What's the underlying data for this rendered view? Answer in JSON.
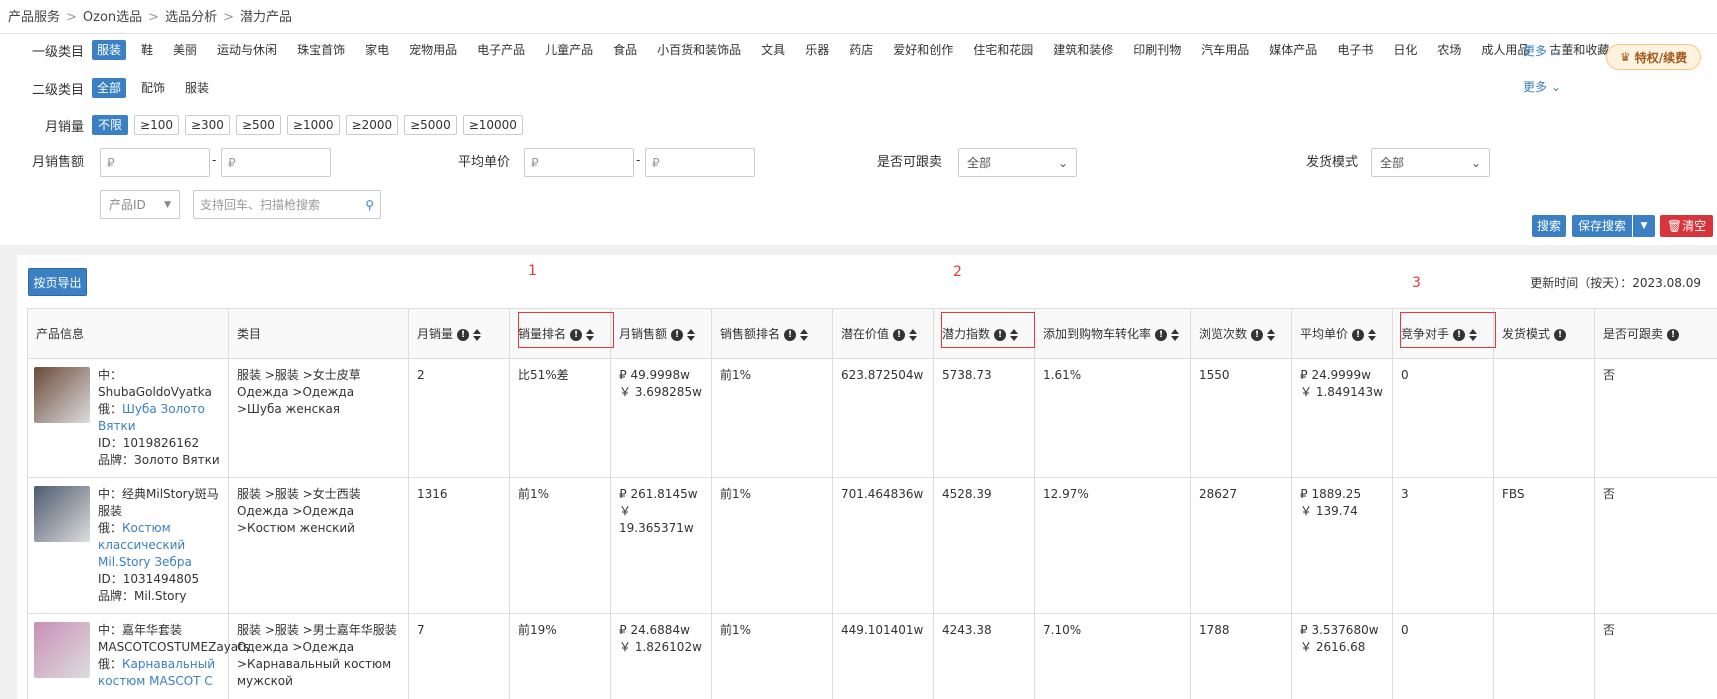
{
  "breadcrumb": [
    "产品服务",
    "Ozon选品",
    "选品分析",
    "潜力产品"
  ],
  "vip_label": "特权/续费",
  "filters": {
    "cat1": {
      "label": "一级类目",
      "items": [
        "服装",
        "鞋",
        "美丽",
        "运动与休闲",
        "珠宝首饰",
        "家电",
        "宠物用品",
        "电子产品",
        "儿童产品",
        "食品",
        "小百货和装饰品",
        "文具",
        "乐器",
        "药店",
        "爱好和创作",
        "住宅和花园",
        "建筑和装修",
        "印刷刊物",
        "汽车用品",
        "媒体产品",
        "电子书",
        "日化",
        "农场",
        "成人用品",
        "古董和收藏"
      ],
      "more": "更多"
    },
    "cat2": {
      "label": "二级类目",
      "items": [
        "全部",
        "配饰",
        "服装"
      ],
      "more": "更多"
    },
    "monthly_sales": {
      "label": "月销量",
      "items": [
        "不限",
        "≥100",
        "≥300",
        "≥500",
        "≥1000",
        "≥2000",
        "≥5000",
        "≥10000"
      ]
    },
    "monthly_amount": {
      "label": "月销售额",
      "min_placeholder": "₽",
      "max_placeholder": "₽",
      "dash": "-"
    },
    "avg_price": {
      "label": "平均单价",
      "min_placeholder": "₽",
      "max_placeholder": "₽",
      "dash": "-"
    },
    "followable": {
      "label": "是否可跟卖",
      "value": "全部"
    },
    "ship_mode": {
      "label": "发货模式",
      "value": "全部"
    },
    "id_select": "产品ID",
    "search_placeholder": "支持回车、扫描枪搜索"
  },
  "buttons": {
    "search": "搜索",
    "save_search": "保存搜索",
    "clear": "清空",
    "export": "按页导出"
  },
  "update_time": "更新时间（按天）：2023.08.09",
  "columns": [
    {
      "label": "产品信息",
      "icons": false
    },
    {
      "label": "类目",
      "icons": false
    },
    {
      "label": "月销量",
      "icons": true
    },
    {
      "label": "销量排名",
      "icons": true
    },
    {
      "label": "月销售额",
      "icons": true
    },
    {
      "label": "销售额排名",
      "icons": true
    },
    {
      "label": "潜在价值",
      "icons": true
    },
    {
      "label": "潜力指数",
      "icons": true
    },
    {
      "label": "添加到购物车转化率",
      "icons": true
    },
    {
      "label": "浏览次数",
      "icons": true
    },
    {
      "label": "平均单价",
      "icons": true
    },
    {
      "label": "竞争对手",
      "icons": true
    },
    {
      "label": "发货模式",
      "icons": "info"
    },
    {
      "label": "是否可跟卖",
      "icons": "info"
    }
  ],
  "annotations": [
    "1",
    "2",
    "3"
  ],
  "rows": [
    {
      "cn": "中：ShubaGoldoVyatka",
      "ru_label": "俄：",
      "ru": "Шуба Золото Вятки",
      "id": "ID：1019826162",
      "brand": "品牌：Золото Вятки",
      "cat1": "服装 >服装 >女士皮草",
      "cat2": "Одежда >Одежда >Шуба женская",
      "sales": "2",
      "sales_rank": "比51%差",
      "amount_rub": "₽ 49.9998w",
      "amount_cny": "￥ 3.698285w",
      "amount_rank": "前1%",
      "potential_value": "623.872504w",
      "potential_index": "5738.73",
      "cart_rate": "1.61%",
      "views": "1550",
      "price_rub": "₽ 24.9999w",
      "price_cny": "￥ 1.849143w",
      "competitors": "0",
      "ship": "",
      "follow": "否"
    },
    {
      "cn": "中：经典MilStory斑马服装",
      "ru_label": "俄：",
      "ru": "Костюм классический Mil.Story Зебра",
      "id": "ID：1031494805",
      "brand": "品牌：Mil.Story",
      "cat1": "服装 >服装 >女士西装",
      "cat2": "Одежда >Одежда >Костюм женский",
      "sales": "1316",
      "sales_rank": "前1%",
      "amount_rub": "₽ 261.8145w",
      "amount_cny": "￥ 19.365371w",
      "amount_rank": "前1%",
      "potential_value": "701.464836w",
      "potential_index": "4528.39",
      "cart_rate": "12.97%",
      "views": "28627",
      "price_rub": "₽ 1889.25",
      "price_cny": "￥ 139.74",
      "competitors": "3",
      "ship": "FBS",
      "follow": "否"
    },
    {
      "cn": "中：嘉年华套装MASCOTCOSTUMEZayats",
      "ru_label": "俄：",
      "ru": "Карнавальный костюм MASCOT C",
      "id": "",
      "brand": "",
      "cat1": "服装 >服装 >男士嘉年华服装",
      "cat2": "Одежда >Одежда >Карнавальный костюм мужской",
      "sales": "7",
      "sales_rank": "前19%",
      "amount_rub": "₽ 24.6884w",
      "amount_cny": "￥ 1.826102w",
      "amount_rank": "前1%",
      "potential_value": "449.101401w",
      "potential_index": "4243.38",
      "cart_rate": "7.10%",
      "views": "1788",
      "price_rub": "₽ 3.537680w",
      "price_cny": "￥ 2616.68",
      "competitors": "0",
      "ship": "",
      "follow": "否"
    }
  ]
}
